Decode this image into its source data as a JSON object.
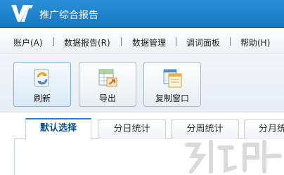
{
  "window": {
    "title": "推广综合报告",
    "logo_icon": "v7-logo-icon"
  },
  "menubar": {
    "items": [
      {
        "label": "账户(A)"
      },
      {
        "label": "数据报告(R)"
      },
      {
        "label": "数据管理"
      },
      {
        "label": "调词面板"
      },
      {
        "label": "帮助(H)"
      }
    ]
  },
  "toolbar": {
    "buttons": [
      {
        "label": "刷新",
        "icon": "refresh-icon"
      },
      {
        "label": "导出",
        "icon": "export-icon"
      },
      {
        "label": "复制窗口",
        "icon": "copy-window-icon"
      }
    ]
  },
  "tabs": [
    {
      "label": "默认选择",
      "active": true
    },
    {
      "label": "分日统计",
      "active": false
    },
    {
      "label": "分周统计",
      "active": false
    },
    {
      "label": "分月统计",
      "active": false
    }
  ],
  "colors": {
    "titlebar": "#1f84cf",
    "active_tab_text": "#0d4f8b"
  }
}
